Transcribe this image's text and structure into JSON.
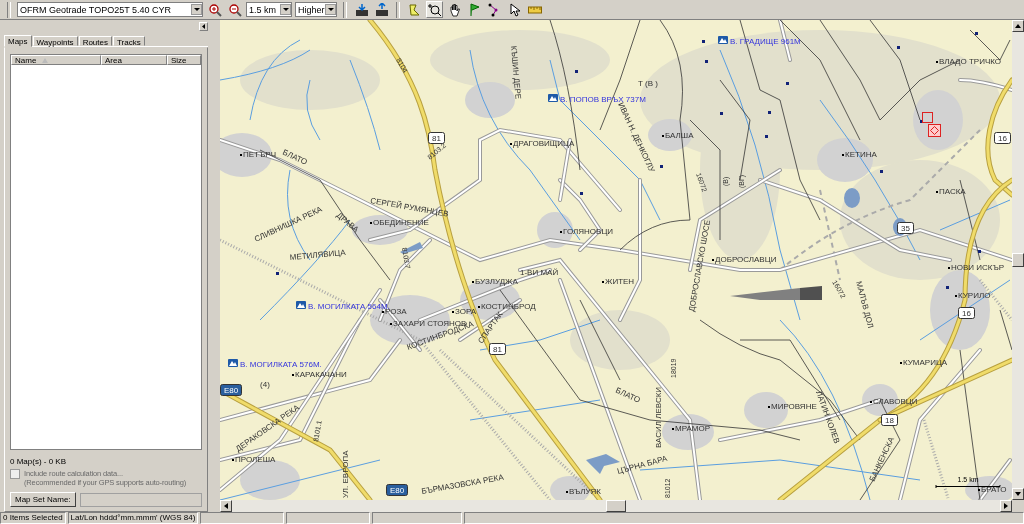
{
  "toolbar": {
    "map_product": "OFRM Geotrade TOPO25T 5.40 CYR",
    "zoom_scale": "1.5 km",
    "detail": "Higher"
  },
  "left_panel": {
    "tabs": [
      {
        "label": "Maps",
        "selected": true
      },
      {
        "label": "Waypoints",
        "selected": false
      },
      {
        "label": "Routes",
        "selected": false
      },
      {
        "label": "Tracks",
        "selected": false
      }
    ],
    "columns": [
      {
        "label": "Name",
        "sorted": true
      },
      {
        "label": "Area",
        "sorted": false
      },
      {
        "label": "Size",
        "sorted": false
      }
    ],
    "summary": "0 Map(s) - 0 KB",
    "routing_option": {
      "label": "Include route calculation data...",
      "note": "(Recommended if your GPS supports auto-routing)",
      "checked": false,
      "disabled": true
    },
    "map_set_name_button": "Map Set Name:"
  },
  "map": {
    "peaks": [
      "В. ГРАДИЩЕ 961М",
      "В. ПОПОВ ВРЪХ 737М",
      "В. МОГИЛКАТА 564М.",
      "В. МОГИЛКАТА 576М."
    ],
    "places": [
      "ВЛАДО ТРИЧКО",
      "БАЛША",
      "ДРАГОВИЩИЦА",
      "ПЕТЪРЧ",
      "КЕТИНА",
      "ПАСКА",
      "ОБЕДИНЕНИЕ",
      "ГОЛЯНОВЦИ",
      "ДОБРОСЛАВЦИ",
      "НОВИ ИСКЪР",
      "БУЗЛУДЖА",
      "ЖИТЕН",
      "КУРИЛО",
      "КОСТИНБРОД",
      "РОЗА",
      "ЗОРА",
      "ЗАХАРИ СТОЯНОВ",
      "КУМАРИЦА",
      "КАРАКАЧАНИ",
      "СЛАВОВЦИ",
      "МИРОВЯНЕ",
      "МРАМОР",
      "ПРОЛЕША",
      "БРАТО",
      "ВЪЛУЯК"
    ],
    "street_labels": [
      "КЪШИН ДЕРЕ",
      "Т (В )",
      "ИВАН Н. ДЕНКОГЛУ",
      "БЛАТО",
      "СЕРГЕЙ РУМЯНЦЕВ",
      "ДРАВА",
      "СЛИВНИШКА РЕКА",
      "ДОБРОСЛАВСКО ШОСЕ",
      "МЕТИЛЯВИЦА",
      "1-ВИ МАЙ",
      "МАЛЪВ ДОЛ",
      "СПАРТАК",
      "КОСТИНБРОДСКА",
      "ЛАТИН КОЛЕВ",
      "ВАСИЛ ЛЕВСКИ",
      "БЛАТО",
      "ДЕРАКОВСКА РЕКА",
      "БАНКЕНСКА",
      "УЛ. ЕВРОПА",
      "ЦЪРНА БАРА",
      "БЪРМАЗОВСКА РЕКА"
    ],
    "road_numbers": [
      "8104",
      "8103.2",
      "(В)",
      "(ВГ)",
      "16072",
      "8103.7",
      "16072",
      "18019",
      "8101.1",
      "81012"
    ],
    "shields": [
      {
        "text": "81",
        "kind": "national"
      },
      {
        "text": "16",
        "kind": "national"
      },
      {
        "text": "35",
        "kind": "national"
      },
      {
        "text": "16",
        "kind": "national"
      },
      {
        "text": "81",
        "kind": "national"
      },
      {
        "text": "(4)",
        "kind": "local"
      },
      {
        "text": "E80",
        "kind": "european"
      },
      {
        "text": "18",
        "kind": "national"
      },
      {
        "text": "E80",
        "kind": "european"
      }
    ],
    "scale_label": "1.5 km"
  },
  "status_bar": [
    "0 Items Selected",
    "Lat/Lon hddd°mm.mmm' (WGS 84)"
  ]
}
